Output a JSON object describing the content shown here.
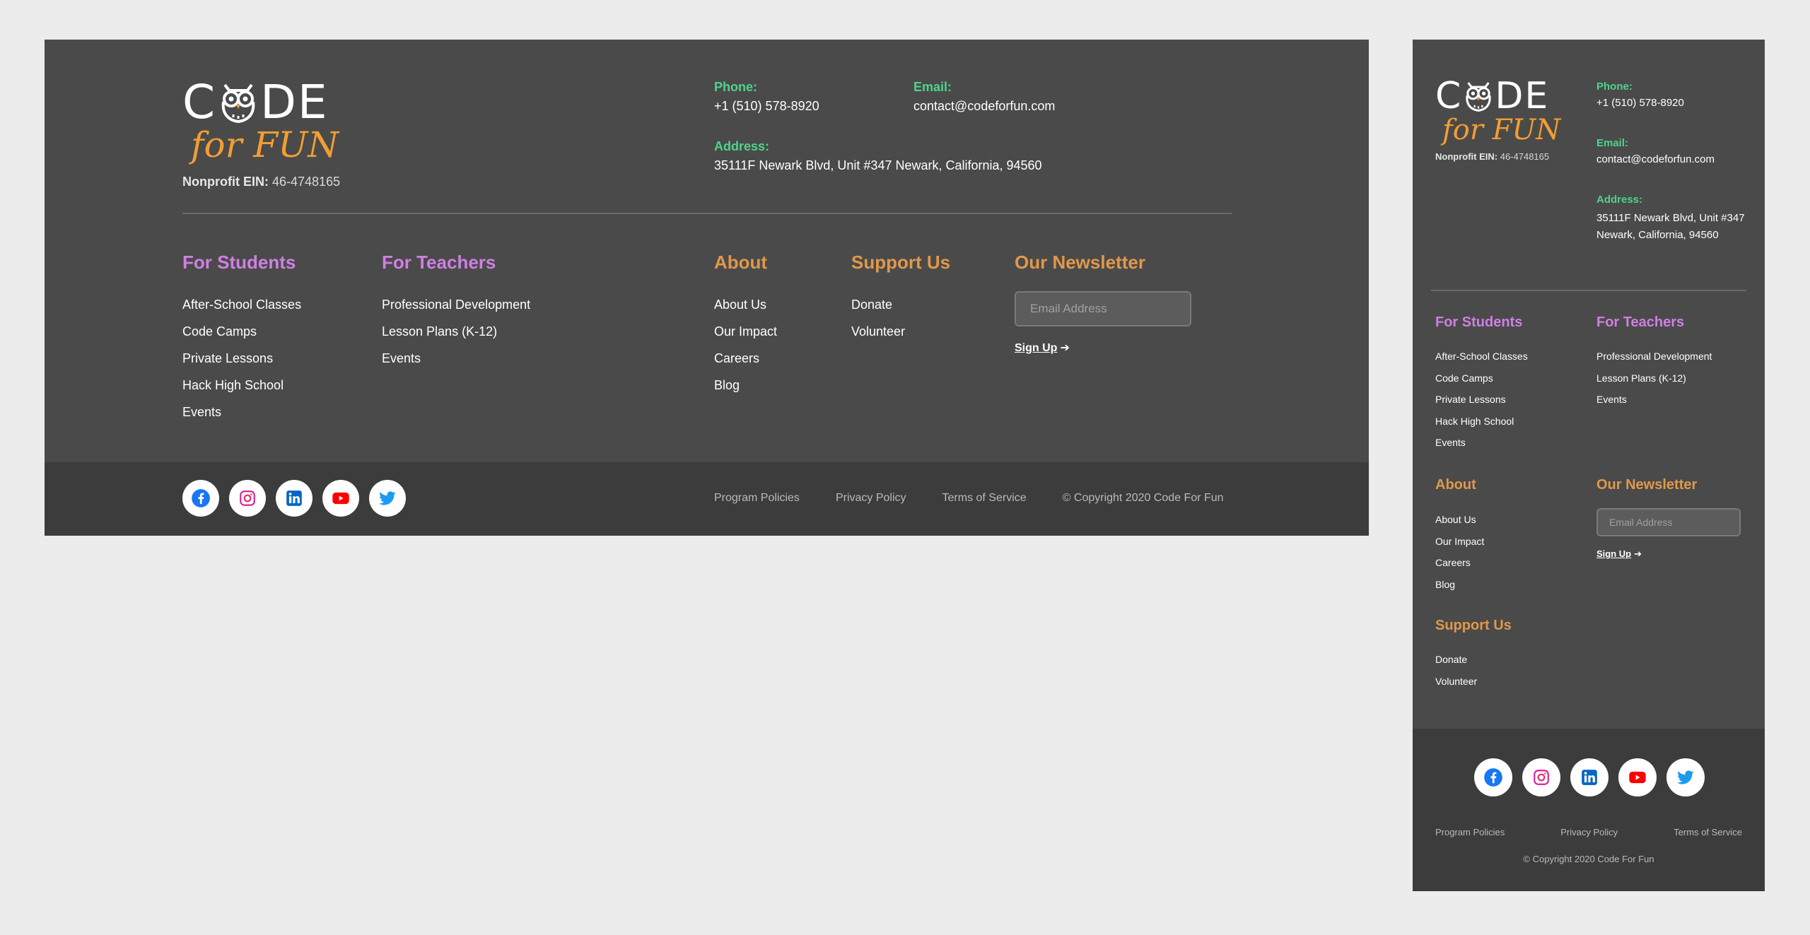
{
  "brand": {
    "code_left": "C",
    "code_right": "DE",
    "sub": "for FUN",
    "ein_label": "Nonprofit EIN:",
    "ein_value": "46-4748165"
  },
  "contact": {
    "phone_label": "Phone:",
    "phone": "+1 (510) 578-8920",
    "email_label": "Email:",
    "email": "contact@codeforfun.com",
    "address_label": "Address:",
    "address": "35111F Newark Blvd, Unit #347 Newark, California, 94560"
  },
  "columns": {
    "students": {
      "title": "For Students",
      "items": [
        "After-School Classes",
        "Code Camps",
        "Private Lessons",
        "Hack High School",
        "Events"
      ]
    },
    "teachers": {
      "title": "For Teachers",
      "items": [
        "Professional Development",
        "Lesson Plans (K-12)",
        "Events"
      ]
    },
    "about": {
      "title": "About",
      "items": [
        "About Us",
        "Our Impact",
        "Careers",
        "Blog"
      ]
    },
    "support": {
      "title": "Support Us",
      "items": [
        "Donate",
        "Volunteer"
      ]
    },
    "newsletter": {
      "title": "Our Newsletter",
      "placeholder": "Email Address",
      "signup": "Sign Up"
    }
  },
  "legal": {
    "program": "Program Policies",
    "privacy": "Privacy Policy",
    "terms": "Terms of Service",
    "copyright": "© Copyright 2020 Code For Fun"
  },
  "social": [
    "facebook-icon",
    "instagram-icon",
    "linkedin-icon",
    "youtube-icon",
    "twitter-icon"
  ],
  "colors": {
    "panel": "#4a4a4a",
    "panel_dark": "#3c3c3c",
    "accent_green": "#4fd38a",
    "accent_purple": "#cf7fe3",
    "accent_orange": "#e0984a"
  }
}
